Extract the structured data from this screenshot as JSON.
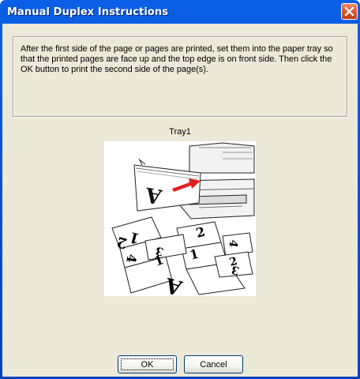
{
  "window": {
    "title": "Manual Duplex Instructions"
  },
  "instructions": {
    "text": "After the first side of the page or pages are printed, set them into the paper tray so that the printed pages are face up and the top edge is on front side. Then click the OK button to print the second side of the page(s)."
  },
  "tray": {
    "label": "Tray1"
  },
  "buttons": {
    "ok_label": "OK",
    "cancel_label": "Cancel"
  },
  "illustration": {
    "page_labels": [
      "A",
      "2",
      "1",
      "2",
      "1",
      "4",
      "3",
      "1",
      "4",
      "3",
      "2",
      "A"
    ]
  },
  "colors": {
    "titlebar": "#0542c0",
    "dialog_bg": "#ece9d8",
    "close_button": "#d5562e",
    "arrow": "#e02020"
  }
}
